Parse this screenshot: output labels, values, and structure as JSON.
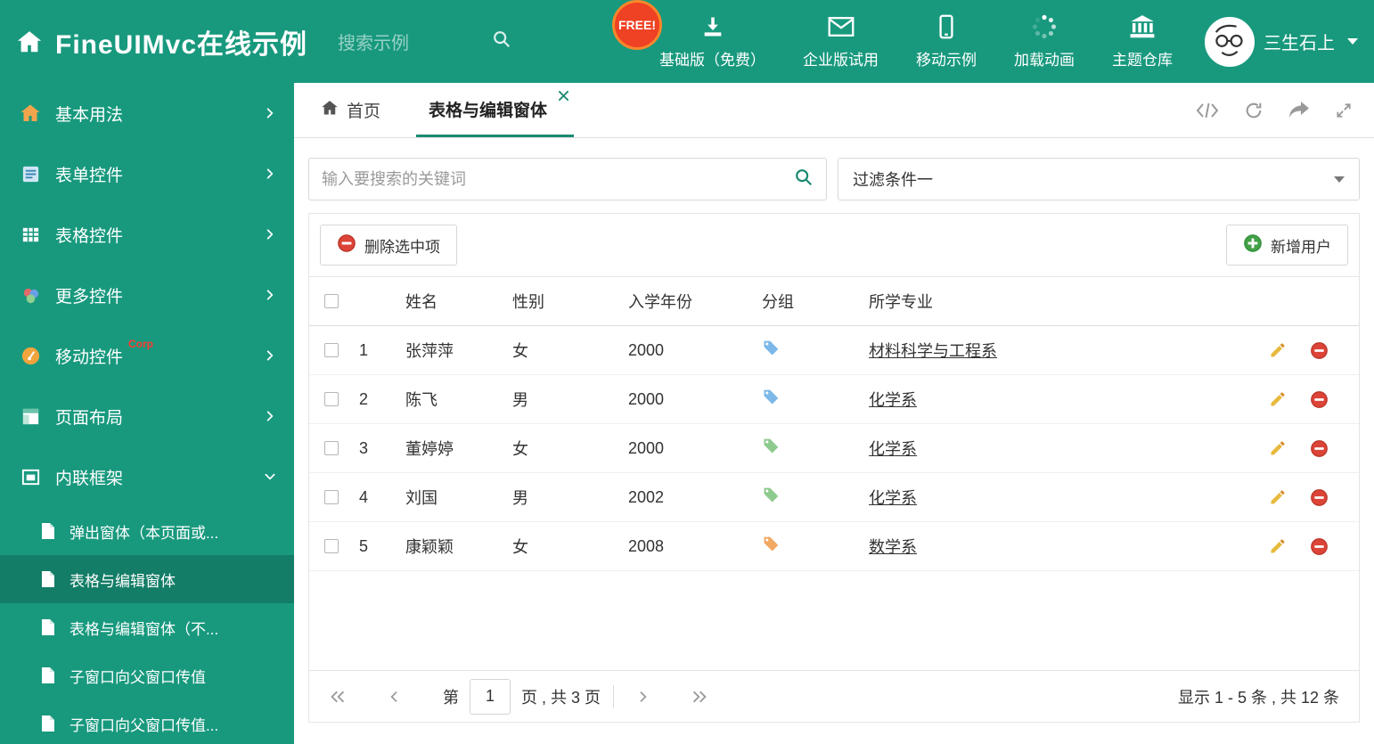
{
  "colors": {
    "theme": "#18997e",
    "accent": "#1a8a72",
    "danger": "#dc4437",
    "success": "#43a047",
    "pencil": "#e7b93c",
    "free_badge": "#ef4123"
  },
  "header": {
    "title": "FineUIMvc在线示例",
    "search_placeholder": "搜索示例",
    "free_badge": "FREE!",
    "nav_items": [
      {
        "label": "基础版（免费）"
      },
      {
        "label": "企业版试用"
      },
      {
        "label": "移动示例"
      },
      {
        "label": "加载动画"
      },
      {
        "label": "主题仓库"
      }
    ],
    "username": "三生石上"
  },
  "sidebar": {
    "items": [
      {
        "label": "基本用法"
      },
      {
        "label": "表单控件"
      },
      {
        "label": "表格控件"
      },
      {
        "label": "更多控件"
      },
      {
        "label": "移动控件",
        "badge": "Corp"
      },
      {
        "label": "页面布局"
      },
      {
        "label": "内联框架"
      }
    ],
    "subitems": [
      {
        "label": "弹出窗体（本页面或..."
      },
      {
        "label": "表格与编辑窗体"
      },
      {
        "label": "表格与编辑窗体（不..."
      },
      {
        "label": "子窗口向父窗口传值"
      },
      {
        "label": "子窗口向父窗口传值..."
      }
    ]
  },
  "tabs": [
    {
      "label": "首页"
    },
    {
      "label": "表格与编辑窗体"
    }
  ],
  "filter_bar": {
    "search_placeholder": "输入要搜索的关键词",
    "dropdown_value": "过滤条件一"
  },
  "grid": {
    "delete_button": "删除选中项",
    "add_button": "新增用户",
    "columns": [
      "姓名",
      "性别",
      "入学年份",
      "分组",
      "所学专业"
    ],
    "rows": [
      {
        "num": "1",
        "name": "张萍萍",
        "gender": "女",
        "year": "2000",
        "tag_color": "#7db8e8",
        "major": "材料科学与工程系"
      },
      {
        "num": "2",
        "name": "陈飞",
        "gender": "男",
        "year": "2000",
        "tag_color": "#7db8e8",
        "major": "化学系"
      },
      {
        "num": "3",
        "name": "董婷婷",
        "gender": "女",
        "year": "2000",
        "tag_color": "#8fca8f",
        "major": "化学系"
      },
      {
        "num": "4",
        "name": "刘国",
        "gender": "男",
        "year": "2002",
        "tag_color": "#8fca8f",
        "major": "化学系"
      },
      {
        "num": "5",
        "name": "康颖颖",
        "gender": "女",
        "year": "2008",
        "tag_color": "#f2a964",
        "major": "数学系"
      }
    ]
  },
  "pagination": {
    "prefix": "第",
    "current_page": "1",
    "suffix": "页 , 共 3 页",
    "summary": "显示 1 - 5 条 , 共 12 条"
  }
}
